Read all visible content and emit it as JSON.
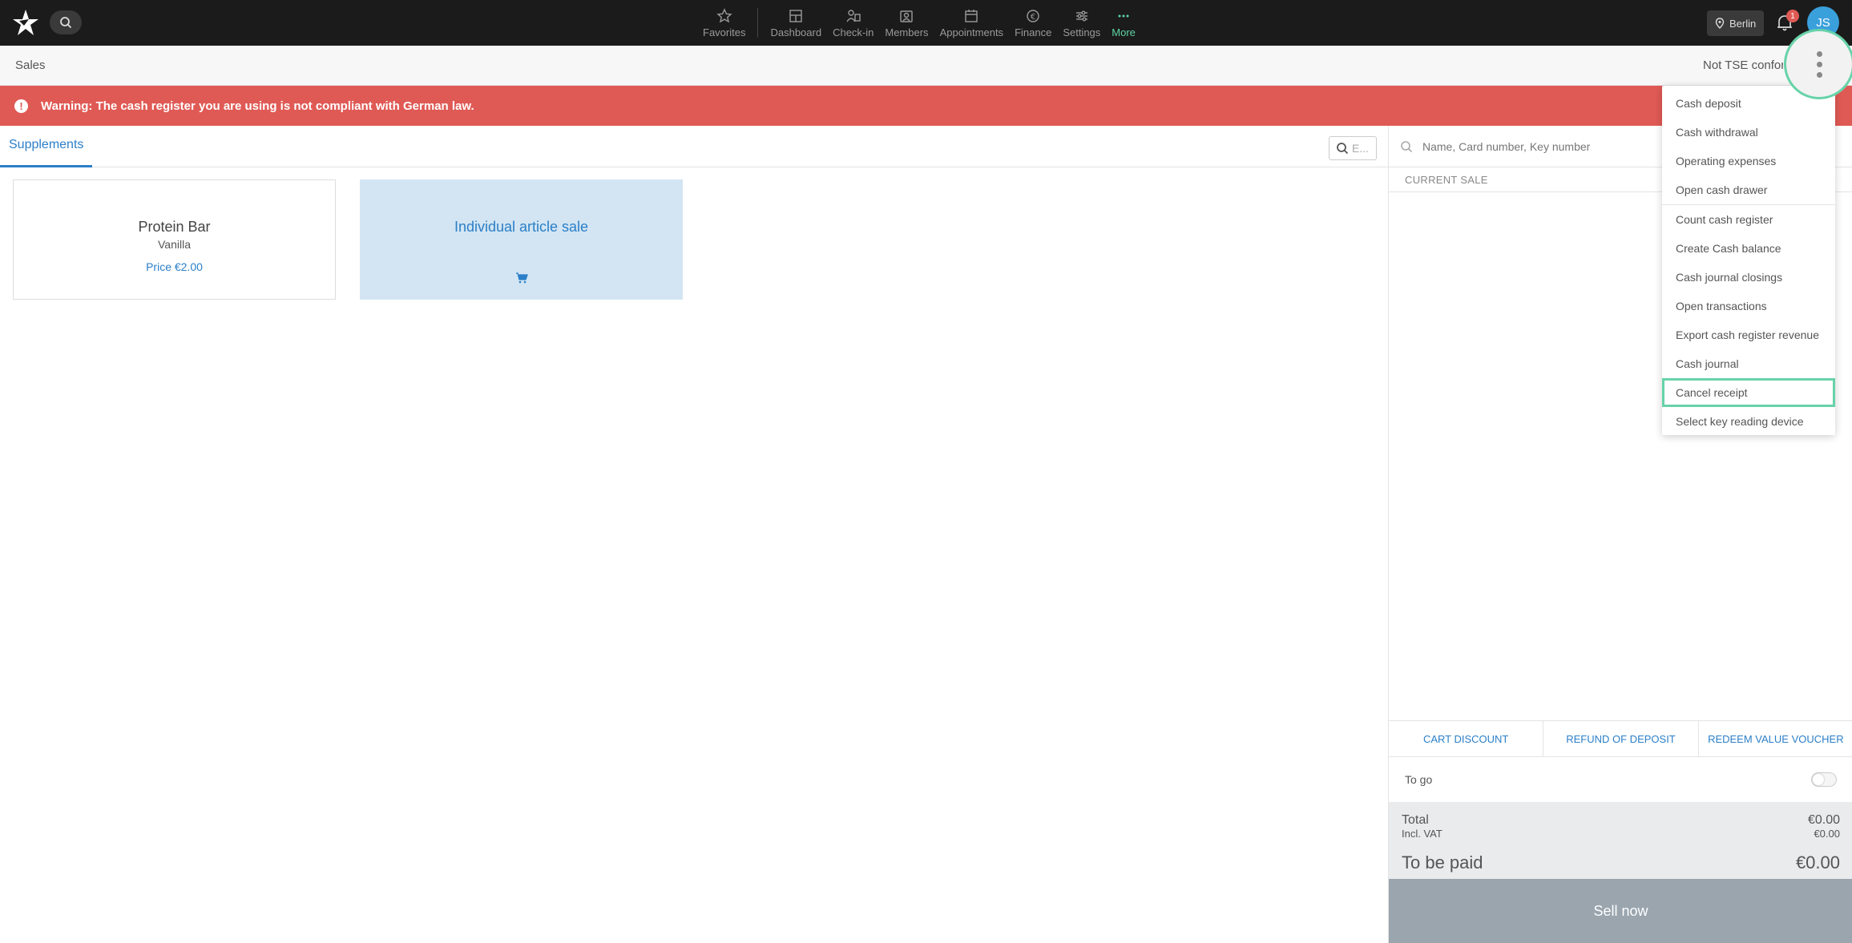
{
  "nav": {
    "items": [
      {
        "label": "Favorites",
        "icon": "star-icon"
      },
      {
        "label": "Dashboard",
        "icon": "dashboard-icon"
      },
      {
        "label": "Check-in",
        "icon": "check-in-icon"
      },
      {
        "label": "Members",
        "icon": "members-icon"
      },
      {
        "label": "Appointments",
        "icon": "calendar-icon"
      },
      {
        "label": "Finance",
        "icon": "euro-icon"
      },
      {
        "label": "Settings",
        "icon": "sliders-icon"
      },
      {
        "label": "More",
        "icon": "more-icon"
      }
    ],
    "location": "Berlin",
    "notification_count": "1",
    "avatar_initials": "JS"
  },
  "subbar": {
    "title": "Sales",
    "tse_status": "Not TSE conform"
  },
  "warning": {
    "text": "Warning: The cash register you are using is not compliant with German law."
  },
  "left": {
    "tab": "Supplements",
    "search_placeholder": "E..."
  },
  "products": [
    {
      "name": "Protein Bar",
      "variant": "Vanilla",
      "price": "Price €2.00"
    }
  ],
  "individual_sale": {
    "label": "Individual article sale"
  },
  "right": {
    "member_search_placeholder": "Name, Card number, Key number",
    "current_sale_label": "CURRENT SALE",
    "actions": [
      "CART DISCOUNT",
      "REFUND OF DEPOSIT",
      "REDEEM VALUE VOUCHER"
    ],
    "to_go_label": "To go",
    "total_label": "Total",
    "total_value": "€0.00",
    "vat_label": "Incl. VAT",
    "vat_value": "€0.00",
    "to_be_paid_label": "To be paid",
    "to_be_paid_value": "€0.00",
    "sell_button": "Sell now"
  },
  "menu": {
    "items": [
      "Cash deposit",
      "Cash withdrawal",
      "Operating expenses",
      "Open cash drawer",
      "Count cash register",
      "Create Cash balance",
      "Cash journal closings",
      "Open transactions",
      "Export cash register revenue",
      "Cash journal",
      "Cancel receipt",
      "Select key reading device"
    ]
  }
}
